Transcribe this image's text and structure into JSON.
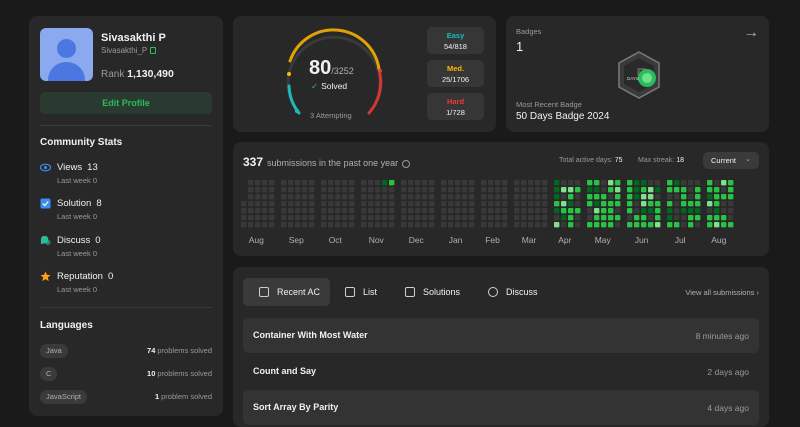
{
  "profile": {
    "name": "Sivasakthi P",
    "username": "Sivasakthi_P",
    "rank_label": "Rank",
    "rank_value": "1,130,490",
    "edit_label": "Edit Profile"
  },
  "community": {
    "title": "Community Stats",
    "stats": [
      {
        "label": "Views",
        "value": "13",
        "sub": "Last week 0",
        "icon": "eye-icon",
        "color": "#3a8eed"
      },
      {
        "label": "Solution",
        "value": "8",
        "sub": "Last week 0",
        "icon": "check-square-icon",
        "color": "#3a8eed"
      },
      {
        "label": "Discuss",
        "value": "0",
        "sub": "Last week 0",
        "icon": "chat-bubble-icon",
        "color": "#2cbb99"
      },
      {
        "label": "Reputation",
        "value": "0",
        "sub": "Last week 0",
        "icon": "star-icon",
        "color": "#ffa116"
      }
    ]
  },
  "languages": {
    "title": "Languages",
    "items": [
      {
        "name": "Java",
        "count": "74",
        "unit": "problems solved"
      },
      {
        "name": "C",
        "count": "10",
        "unit": "problems solved"
      },
      {
        "name": "JavaScript",
        "count": "1",
        "unit": "problem solved"
      }
    ]
  },
  "solved": {
    "count": "80",
    "total": "/3252",
    "solved_label": "Solved",
    "attempting": "3 Attempting",
    "difficulties": [
      {
        "label": "Easy",
        "value": "54/818",
        "color": "#1cbaba"
      },
      {
        "label": "Med.",
        "value": "25/1706",
        "color": "#ffb800"
      },
      {
        "label": "Hard",
        "value": "1/728",
        "color": "#f63737"
      }
    ]
  },
  "badges": {
    "label": "Badges",
    "count": "1",
    "recent_label": "Most Recent Badge",
    "recent_name": "50 Days Badge 2024",
    "badge_text": "DAYS"
  },
  "heatmap": {
    "count": "337",
    "title_rest": "submissions in the past one year",
    "active_label": "Total active days:",
    "active_value": "75",
    "streak_label": "Max streak:",
    "streak_value": "18",
    "select_value": "Current",
    "months": [
      "Aug",
      "Sep",
      "Oct",
      "Nov",
      "Dec",
      "Jan",
      "Feb",
      "Mar",
      "Apr",
      "May",
      "Jun",
      "Jul",
      "Aug"
    ],
    "colors": {
      "empty": "#393939",
      "l1": "#016620",
      "l2": "#28c244",
      "l3": "#7fe18b"
    }
  },
  "recent": {
    "tabs": [
      {
        "label": "Recent AC",
        "icon": "recent-ac-icon"
      },
      {
        "label": "List",
        "icon": "list-icon"
      },
      {
        "label": "Solutions",
        "icon": "solutions-icon"
      },
      {
        "label": "Discuss",
        "icon": "discuss-icon"
      }
    ],
    "view_all": "View all submissions",
    "rows": [
      {
        "title": "Container With Most Water",
        "time": "8 minutes ago"
      },
      {
        "title": "Count and Say",
        "time": "2 days ago"
      },
      {
        "title": "Sort Array By Parity",
        "time": "4 days ago"
      }
    ]
  }
}
